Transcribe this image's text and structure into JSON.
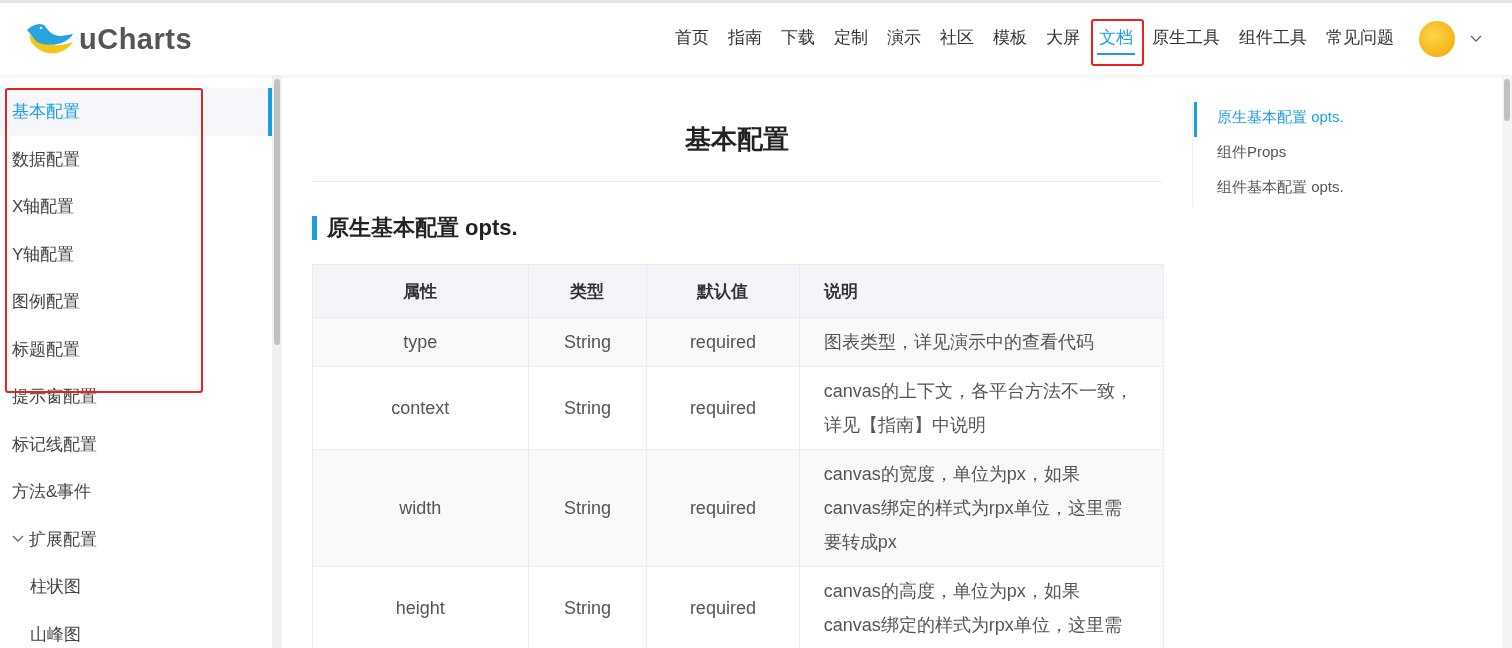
{
  "logo": {
    "text": "uCharts"
  },
  "nav": [
    {
      "label": "首页",
      "selected": false
    },
    {
      "label": "指南",
      "selected": false
    },
    {
      "label": "下载",
      "selected": false
    },
    {
      "label": "定制",
      "selected": false
    },
    {
      "label": "演示",
      "selected": false
    },
    {
      "label": "社区",
      "selected": false
    },
    {
      "label": "模板",
      "selected": false
    },
    {
      "label": "大屏",
      "selected": false
    },
    {
      "label": "文档",
      "selected": true
    },
    {
      "label": "原生工具",
      "selected": false
    },
    {
      "label": "组件工具",
      "selected": false
    },
    {
      "label": "常见问题",
      "selected": false
    }
  ],
  "sidebar": {
    "items": [
      {
        "label": "基本配置",
        "selected": true
      },
      {
        "label": "数据配置",
        "selected": false
      },
      {
        "label": "X轴配置",
        "selected": false
      },
      {
        "label": "Y轴配置",
        "selected": false
      },
      {
        "label": "图例配置",
        "selected": false
      },
      {
        "label": "标题配置",
        "selected": false
      },
      {
        "label": "提示窗配置",
        "selected": false
      },
      {
        "label": "标记线配置",
        "selected": false
      },
      {
        "label": "方法&事件",
        "selected": false
      },
      {
        "label": "扩展配置",
        "selected": false,
        "expanded": true,
        "children": [
          {
            "label": "柱状图",
            "selected": false
          },
          {
            "label": "山峰图",
            "selected": false
          }
        ]
      }
    ]
  },
  "content": {
    "title": "基本配置",
    "section_title": "原生基本配置 opts.",
    "table": {
      "columns": [
        "属性",
        "类型",
        "默认值",
        "说明"
      ],
      "rows": [
        {
          "property": "type",
          "type": "String",
          "default": "required",
          "description": [
            "图表类型，详见演示中的查看代码"
          ]
        },
        {
          "property": "context",
          "type": "String",
          "default": "required",
          "description": [
            "canvas的上下文，各平台方法不一致，",
            "详见【指南】中说明"
          ]
        },
        {
          "property": "width",
          "type": "String",
          "default": "required",
          "description": [
            "canvas的宽度，单位为px，如果",
            "canvas绑定的样式为rpx单位，这里需",
            "要转成px"
          ]
        },
        {
          "property": "height",
          "type": "String",
          "default": "required",
          "description": [
            "canvas的高度，单位为px，如果",
            "canvas绑定的样式为rpx单位，这里需"
          ]
        }
      ]
    }
  },
  "toc": [
    {
      "label": "原生基本配置 opts.",
      "selected": true
    },
    {
      "label": "组件Props",
      "selected": false
    },
    {
      "label": "组件基本配置 opts.",
      "selected": false
    }
  ]
}
